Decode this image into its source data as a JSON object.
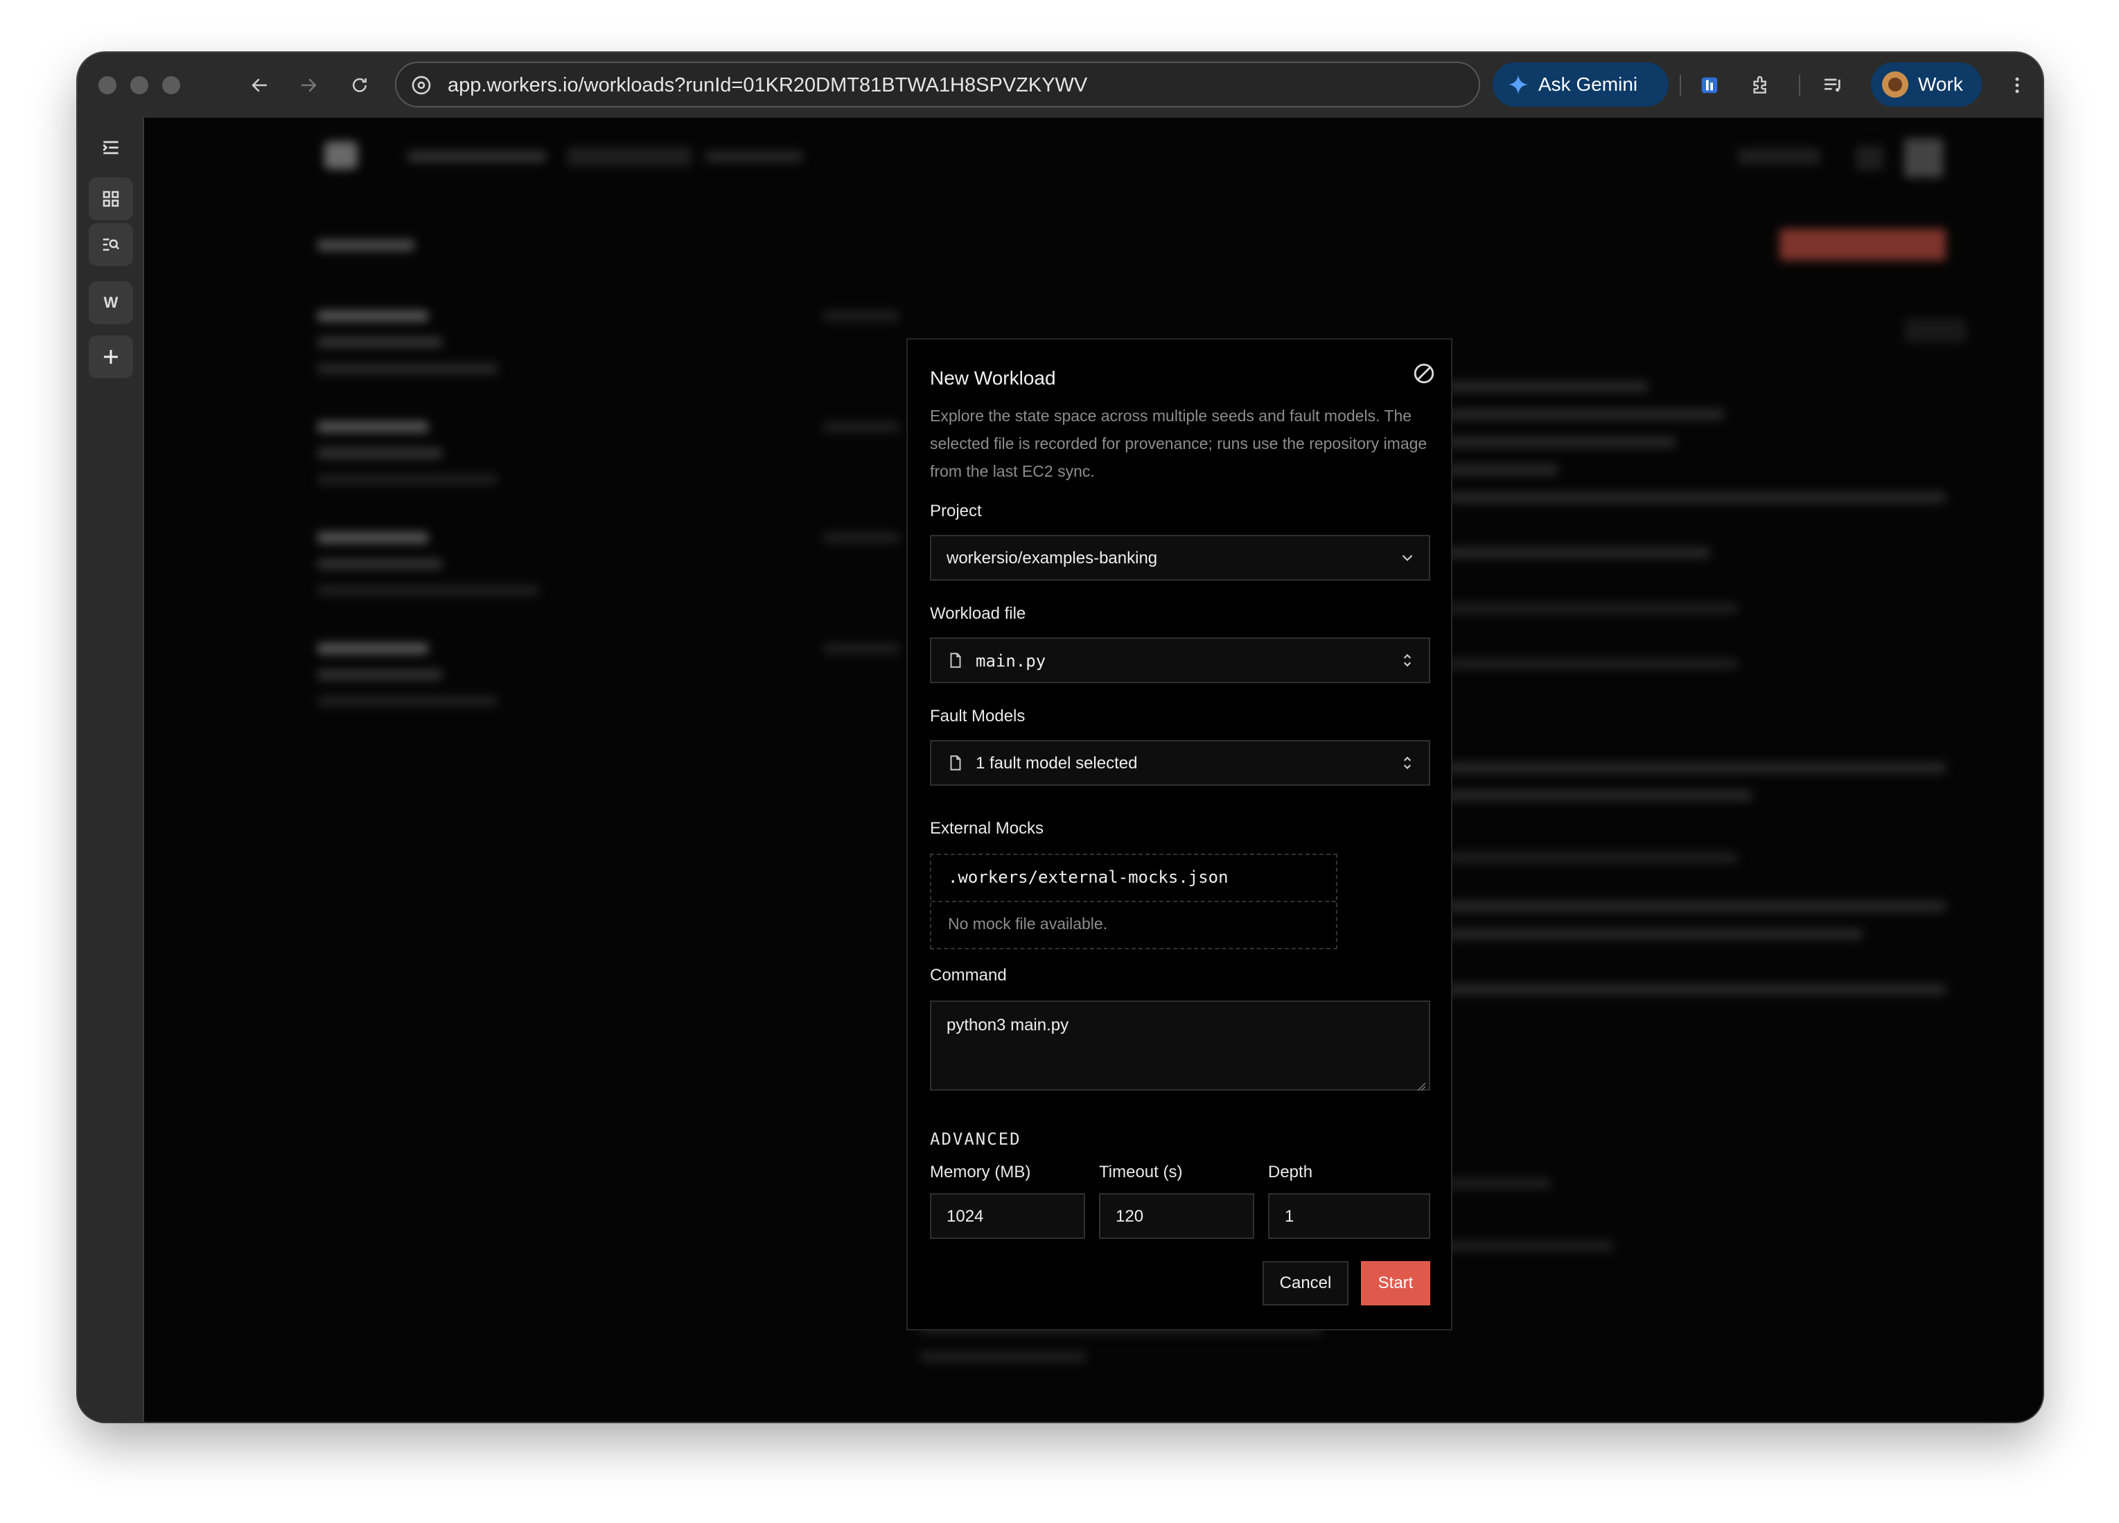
{
  "browser": {
    "url": "app.workers.io/workloads?runId=01KR20DMT81BTWA1H8SPVZKYWV",
    "gemini_label": "Ask Gemini",
    "profile_label": "Work"
  },
  "sidebar_rail": {
    "workspace_letter": "W"
  },
  "modal": {
    "title": "New Workload",
    "description": "Explore the state space across multiple seeds and fault models. The selected file is recorded for provenance; runs use the repository image from the last EC2 sync.",
    "project": {
      "label": "Project",
      "value": "workersio/examples-banking"
    },
    "workload_file": {
      "label": "Workload file",
      "value": "main.py"
    },
    "fault_models": {
      "label": "Fault Models",
      "value": "1 fault model selected"
    },
    "external_mocks": {
      "label": "External Mocks",
      "path": ".workers/external-mocks.json",
      "status": "No mock file available."
    },
    "command": {
      "label": "Command",
      "value": "python3 main.py"
    },
    "advanced": {
      "heading": "ADVANCED",
      "memory": {
        "label": "Memory (MB)",
        "value": "1024"
      },
      "timeout": {
        "label": "Timeout (s)",
        "value": "120"
      },
      "depth": {
        "label": "Depth",
        "value": "1"
      }
    },
    "cancel_label": "Cancel",
    "start_label": "Start"
  },
  "colors": {
    "accent": "#e05a4b",
    "chrome": "#2b2b2b",
    "profile_pill": "#0d3a66",
    "modal_bg": "#000000"
  },
  "icons": [
    "back-arrow-icon",
    "forward-arrow-icon",
    "reload-icon",
    "site-info-icon",
    "gemini-spark-icon",
    "extension-icon",
    "puzzle-icon",
    "media-queue-icon",
    "kebab-menu-icon",
    "sidebar-toggle-icon",
    "grid-icon",
    "search-list-icon",
    "plus-icon",
    "close-icon",
    "chevron-down-icon",
    "file-icon",
    "updown-chevron-icon"
  ]
}
